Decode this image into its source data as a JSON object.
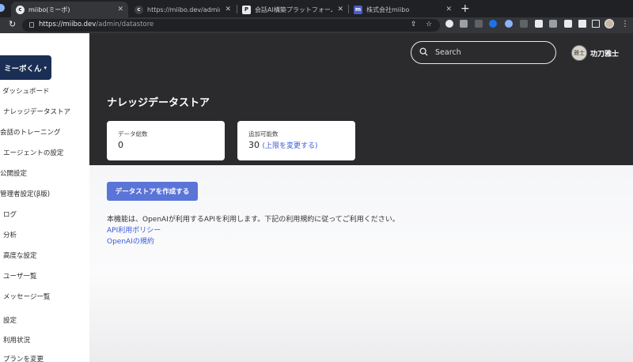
{
  "browser": {
    "tabs": [
      {
        "title": "miibo(ミーボ)",
        "favicon": "miibo-icon",
        "active": true
      },
      {
        "title": "https://miibo.dev/admin/previe",
        "favicon": "page-icon",
        "active": false
      },
      {
        "title": "会話AI構築プラットフォーム「mii",
        "favicon": "p-icon",
        "active": false
      },
      {
        "title": "株式会社miibo",
        "favicon": "miibo-logo-icon",
        "active": false
      }
    ],
    "url_host": "https://miibo.dev",
    "url_path": "/admin/datastore"
  },
  "sidebar": {
    "bot_select_label": "ミーボくん",
    "items": [
      "ダッシュボード",
      "ナレッジデータストア",
      "会話のトレーニング",
      "エージェントの設定",
      "公開設定",
      "管理者設定(β版)",
      "ログ",
      "分析",
      "高度な設定",
      "ユーザ一覧",
      "メッセージ一覧",
      "設定",
      "利用状況",
      "プランを変更"
    ]
  },
  "header": {
    "search_placeholder": "Search",
    "avatar_text": "雅士",
    "user_name": "功刀雅士"
  },
  "page": {
    "title": "ナレッジデータストア",
    "stats": {
      "data_count_label": "データ総数",
      "data_count_value": "0",
      "addable_label": "追加可能数",
      "addable_value": "30",
      "change_limit_link": "(上限を変更する)"
    },
    "create_button": "データストアを作成する",
    "notice": "本機能は、OpenAIが利用するAPIを利用します。下記の利用規約に従ってご利用ください。",
    "policy_link": "API利用ポリシー",
    "terms_link": "OpenAIの規約"
  },
  "colors": {
    "header_bg": "#2b2b2d",
    "accent": "#5b74d8",
    "link": "#3b5bdb",
    "bot_select_bg": "#1b2f55"
  }
}
